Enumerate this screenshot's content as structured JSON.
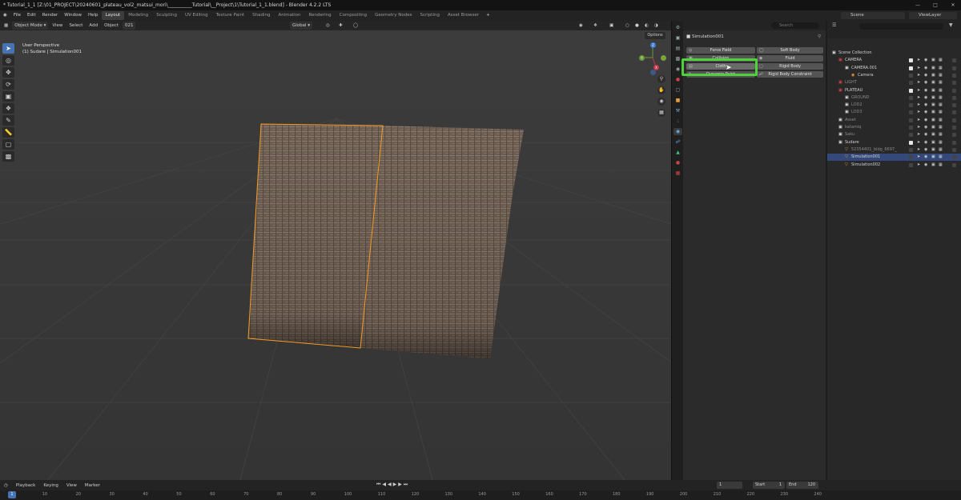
{
  "window_title": "* Tutorial_1_1 [Z:\\01_PROJECT\\20240601_plateau_vol2_matsui_mori\\__________Tutorial\\__Project\\1\\Tutorial_1_1.blend] - Blender 4.2.2 LTS",
  "menu": [
    "File",
    "Edit",
    "Render",
    "Window",
    "Help"
  ],
  "workspaces": [
    "Layout",
    "Modeling",
    "Sculpting",
    "UV Editing",
    "Texture Paint",
    "Shading",
    "Animation",
    "Rendering",
    "Compositing",
    "Geometry Nodes",
    "Scripting",
    "Asset Browser"
  ],
  "active_workspace": "Layout",
  "scene_field": "Scene",
  "viewlayer_field": "ViewLayer",
  "viewport_header": {
    "mode": "Object Mode",
    "menus": [
      "View",
      "Select",
      "Add",
      "Object"
    ],
    "slot": "021",
    "orientation": "Global"
  },
  "viewport": {
    "info_line1": "User Perspective",
    "info_line2": "(1) Sudare | Simulation001",
    "options": "Options"
  },
  "tools": [
    "select-box",
    "cursor",
    "move",
    "rotate",
    "scale",
    "transform",
    "annotate",
    "measure",
    "add-cube",
    "add-object"
  ],
  "properties": {
    "object_name": "Simulation001",
    "search_placeholder": "Search",
    "physics_left": [
      "Force Field",
      "Collision",
      "Cloth",
      "Dynamic Paint"
    ],
    "physics_right": [
      "Soft Body",
      "Fluid",
      "Rigid Body",
      "Rigid Body Constraint"
    ]
  },
  "outliner": {
    "rows": [
      {
        "name": "Scene Collection",
        "indent": 0,
        "type": "collection",
        "sel": false,
        "check": false
      },
      {
        "name": "CAMERA",
        "indent": 1,
        "type": "collection",
        "sel": false,
        "check": true
      },
      {
        "name": "CAMERA.001",
        "indent": 2,
        "type": "collection",
        "sel": false,
        "check": true
      },
      {
        "name": "Camera",
        "indent": 3,
        "type": "camera",
        "sel": false,
        "check": false
      },
      {
        "name": "LIGHT",
        "indent": 1,
        "type": "collection",
        "sel": false,
        "check": false
      },
      {
        "name": "PLATEAU",
        "indent": 1,
        "type": "collection",
        "sel": false,
        "check": true
      },
      {
        "name": "GROUND",
        "indent": 2,
        "type": "collection",
        "sel": false,
        "check": false
      },
      {
        "name": "LOD2",
        "indent": 2,
        "type": "collection",
        "sel": false,
        "check": false
      },
      {
        "name": "LOD3",
        "indent": 2,
        "type": "collection",
        "sel": false,
        "check": false
      },
      {
        "name": "Asset",
        "indent": 1,
        "type": "collection",
        "sel": false,
        "check": false
      },
      {
        "name": "katamiq",
        "indent": 1,
        "type": "collection",
        "sel": false,
        "check": false
      },
      {
        "name": "Saku",
        "indent": 1,
        "type": "collection",
        "sel": false,
        "check": false
      },
      {
        "name": "Sudare",
        "indent": 1,
        "type": "collection",
        "sel": false,
        "check": true
      },
      {
        "name": "52354401_bldg_6697_",
        "indent": 2,
        "type": "mesh",
        "sel": false,
        "check": false
      },
      {
        "name": "Simulation001",
        "indent": 2,
        "type": "mesh",
        "sel": true,
        "check": false
      },
      {
        "name": "Simulation002",
        "indent": 2,
        "type": "mesh",
        "sel": false,
        "check": false
      }
    ]
  },
  "timeline": {
    "menus": [
      "Playback",
      "Keying",
      "View",
      "Marker"
    ],
    "current_frame": "1",
    "start_label": "Start",
    "start": "1",
    "end_label": "End",
    "end": "120",
    "ruler": [
      "1",
      "10",
      "20",
      "30",
      "40",
      "50",
      "60",
      "70",
      "80",
      "90",
      "100",
      "110",
      "120",
      "130",
      "140",
      "150",
      "160",
      "170",
      "180",
      "190",
      "200",
      "210",
      "220",
      "230",
      "240"
    ]
  },
  "colors": {
    "selection_outline": "#f39a26",
    "highlight_box": "#4fd13a",
    "active_blue": "#4772b3"
  }
}
